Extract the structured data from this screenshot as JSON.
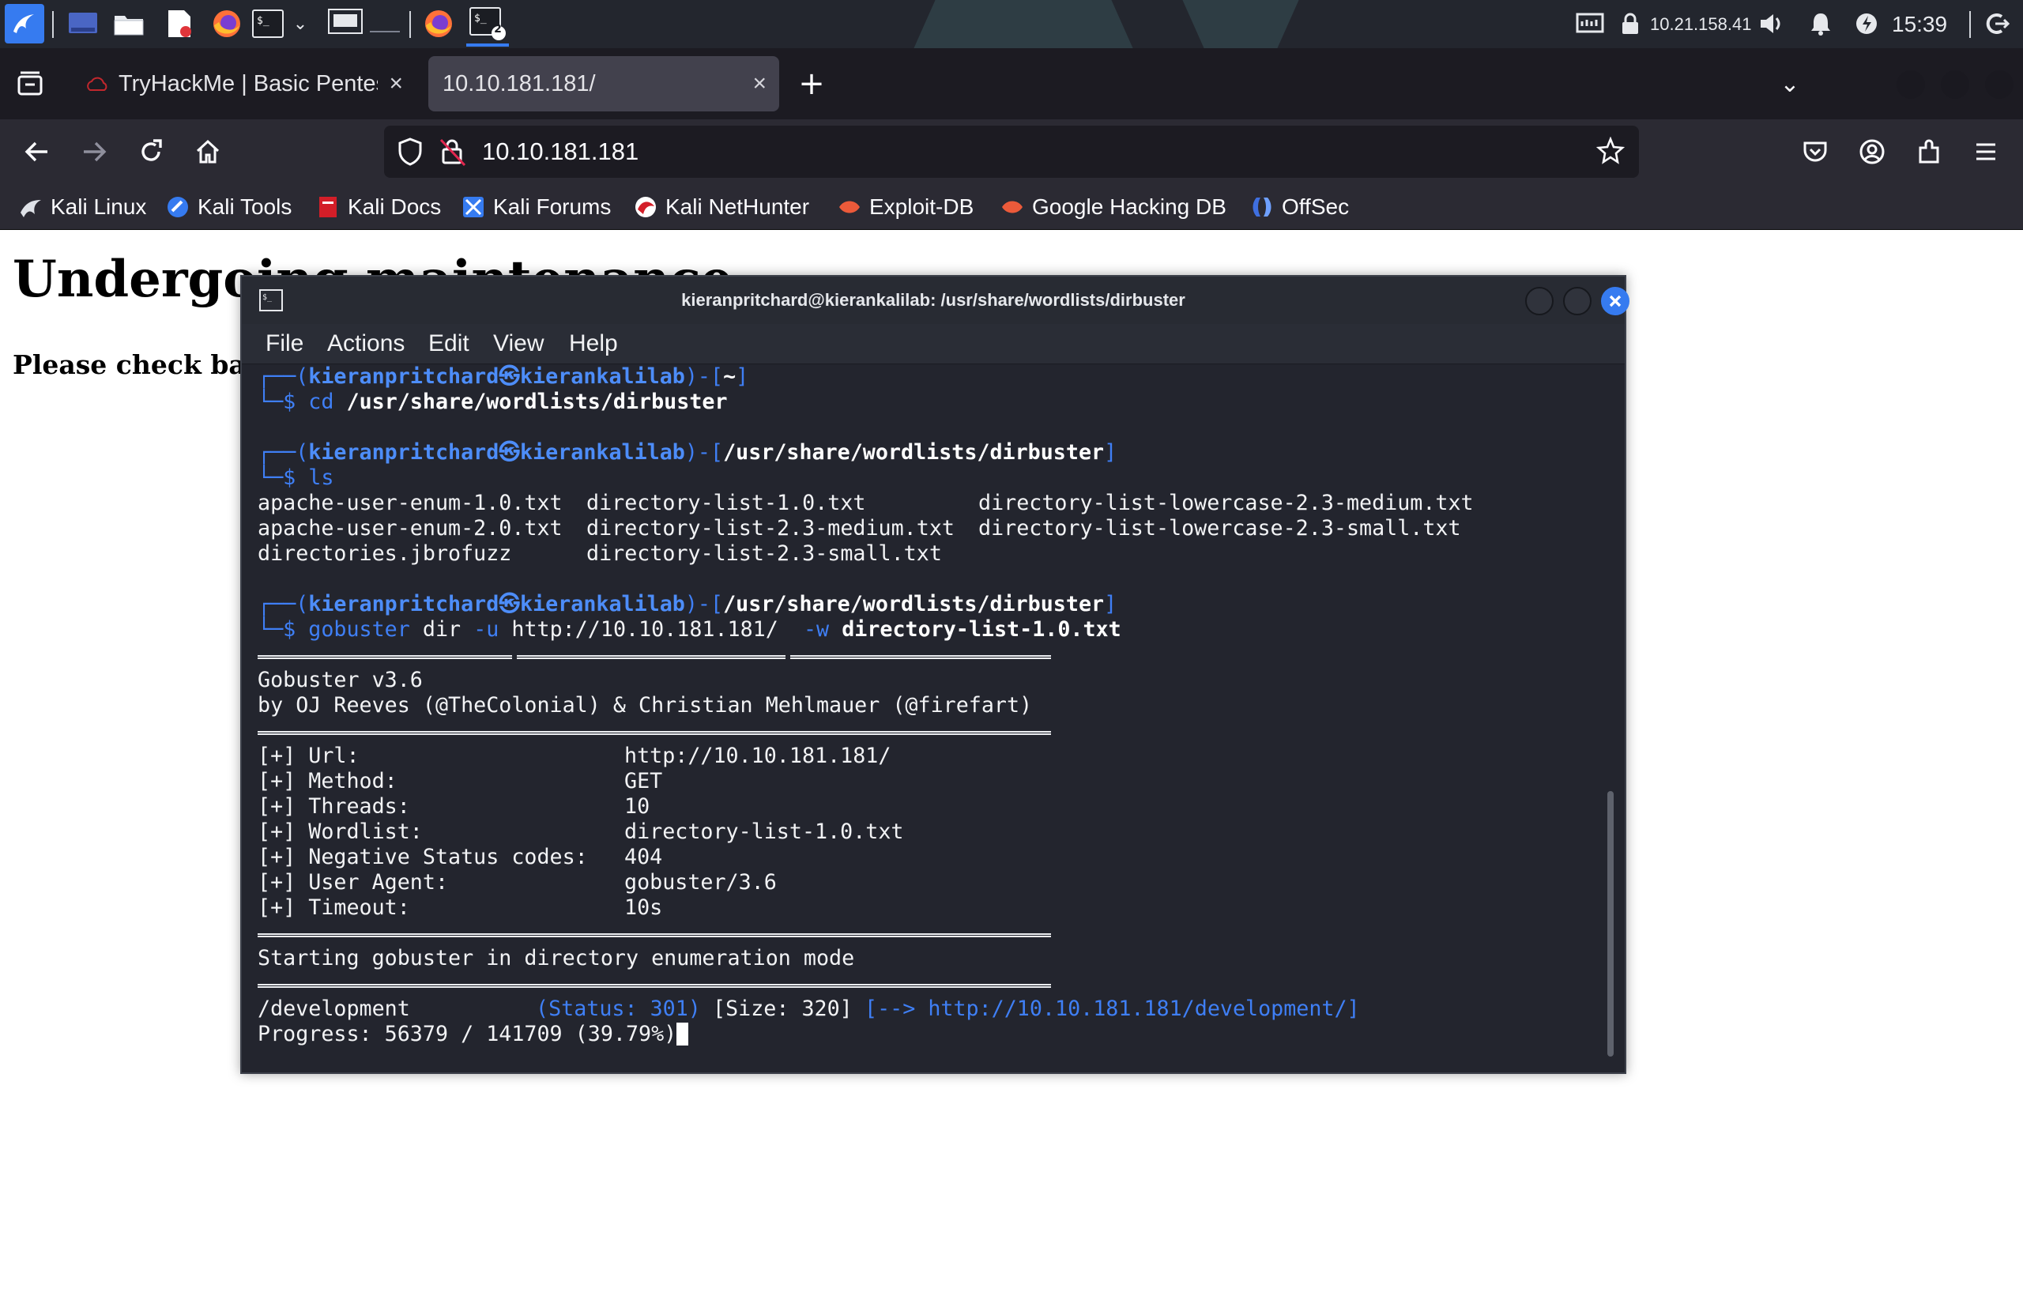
{
  "panel": {
    "ip_address": "10.21.158.41",
    "clock": "15:39",
    "terminal_count_badge": "2"
  },
  "browser": {
    "tabs": [
      {
        "label": "TryHackMe | Basic Pentes",
        "active": false
      },
      {
        "label": "10.10.181.181/",
        "active": true
      }
    ],
    "new_tab_symbol": "+",
    "url": "10.10.181.181",
    "bookmarks": [
      {
        "label": "Kali Linux",
        "icon": "kali-dragon-icon"
      },
      {
        "label": "Kali Tools",
        "icon": "kali-tools-icon"
      },
      {
        "label": "Kali Docs",
        "icon": "kali-docs-icon"
      },
      {
        "label": "Kali Forums",
        "icon": "kali-forums-icon"
      },
      {
        "label": "Kali NetHunter",
        "icon": "nethunter-icon"
      },
      {
        "label": "Exploit-DB",
        "icon": "exploit-db-icon"
      },
      {
        "label": "Google Hacking DB",
        "icon": "ghdb-icon"
      },
      {
        "label": "OffSec",
        "icon": "offsec-icon"
      }
    ]
  },
  "page": {
    "heading": "Undergoing maintenance",
    "subtext": "Please check back later"
  },
  "terminal": {
    "title": "kieranpritchard@kierankalilab: /usr/share/wordlists/dirbuster",
    "menu": [
      "File",
      "Actions",
      "Edit",
      "View",
      "Help"
    ],
    "prompt_user": "kieranpritchard㉿kierankalilab",
    "prompt1_dir": "~",
    "cmd1_name": "cd",
    "cmd1_arg": "/usr/share/wordlists/dirbuster",
    "prompt2_dir": "/usr/share/wordlists/dirbuster",
    "cmd2": "ls",
    "ls_rows": [
      [
        "apache-user-enum-1.0.txt",
        "directory-list-1.0.txt",
        "directory-list-lowercase-2.3-medium.txt"
      ],
      [
        "apache-user-enum-2.0.txt",
        "directory-list-2.3-medium.txt",
        "directory-list-lowercase-2.3-small.txt"
      ],
      [
        "directories.jbrofuzz",
        "directory-list-2.3-small.txt",
        ""
      ]
    ],
    "prompt3_dir": "/usr/share/wordlists/dirbuster",
    "cmd3_name": "gobuster",
    "cmd3_sub": "dir",
    "cmd3_flag_u": "-u",
    "cmd3_url": "http://10.10.181.181/",
    "cmd3_flag_w": "-w",
    "cmd3_wordlist": "directory-list-1.0.txt",
    "banner_version": "Gobuster v3.6",
    "banner_authors": "by OJ Reeves (@TheColonial) & Christian Mehlmauer (@firefart)",
    "config": [
      {
        "key": "[+] Url:",
        "value": "http://10.10.181.181/"
      },
      {
        "key": "[+] Method:",
        "value": "GET"
      },
      {
        "key": "[+] Threads:",
        "value": "10"
      },
      {
        "key": "[+] Wordlist:",
        "value": "directory-list-1.0.txt"
      },
      {
        "key": "[+] Negative Status codes:",
        "value": "404"
      },
      {
        "key": "[+] User Agent:",
        "value": "gobuster/3.6"
      },
      {
        "key": "[+] Timeout:",
        "value": "10s"
      }
    ],
    "start_message": "Starting gobuster in directory enumeration mode",
    "result_path": "/development",
    "result_status": "(Status: 301)",
    "result_size": "[Size: 320]",
    "result_redirect": "[--> http://10.10.181.181/development/]",
    "progress": "Progress: 56379 / 141709 (39.79%)"
  },
  "colors": {
    "accent_blue": "#367bf0",
    "terminal_bg": "#23252e",
    "prompt_blue": "#4d8df9"
  }
}
